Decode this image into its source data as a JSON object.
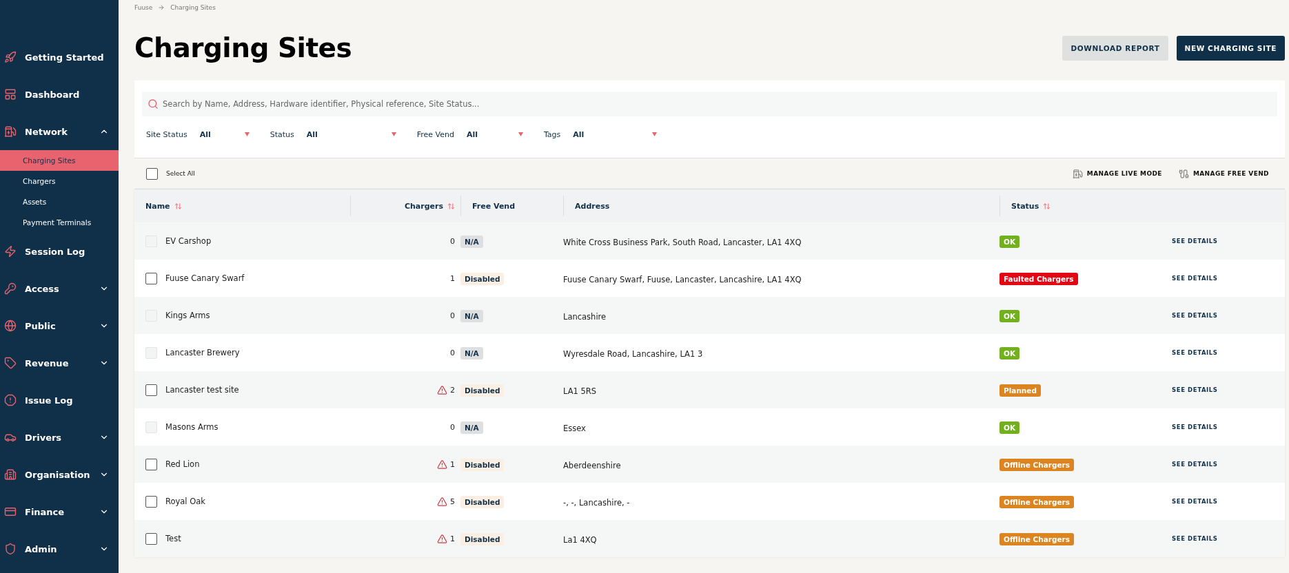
{
  "sidebar": {
    "items": [
      {
        "label": "Getting Started",
        "kind": "link",
        "selected": false
      },
      {
        "label": "Dashboard",
        "kind": "link",
        "selected": false
      },
      {
        "label": "Network",
        "kind": "group",
        "expanded": true,
        "selected": false,
        "children": [
          {
            "label": "Charging Sites",
            "selected": true
          },
          {
            "label": "Chargers",
            "selected": false
          },
          {
            "label": "Assets",
            "selected": false
          },
          {
            "label": "Payment Terminals",
            "selected": false
          }
        ]
      },
      {
        "label": "Session Log",
        "kind": "link",
        "selected": false
      },
      {
        "label": "Access",
        "kind": "group",
        "expanded": false,
        "selected": false
      },
      {
        "label": "Public",
        "kind": "group",
        "expanded": false,
        "selected": false
      },
      {
        "label": "Revenue",
        "kind": "group",
        "expanded": false,
        "selected": false
      },
      {
        "label": "Issue Log",
        "kind": "link",
        "selected": false
      },
      {
        "label": "Drivers",
        "kind": "group",
        "expanded": false,
        "selected": false
      },
      {
        "label": "Organisation",
        "kind": "group",
        "expanded": false,
        "selected": false
      },
      {
        "label": "Finance",
        "kind": "group",
        "expanded": false,
        "selected": false
      },
      {
        "label": "Admin",
        "kind": "group",
        "expanded": false,
        "selected": false
      }
    ]
  },
  "breadcrumb": [
    "Fuuse",
    "Charging Sites"
  ],
  "title": "Charging Sites",
  "buttons": [
    {
      "label": "DOWNLOAD REPORT",
      "kind": "secondary"
    },
    {
      "label": "NEW CHARGING SITE",
      "kind": "primary"
    }
  ],
  "search": {
    "placeholder": "Search by Name, Address, Hardware identifier, Physical reference, Site Status..."
  },
  "filters": [
    {
      "label": "Site Status",
      "value": "All"
    },
    {
      "label": "Status",
      "value": "All"
    },
    {
      "label": "Free Vend",
      "value": "All"
    },
    {
      "label": "Tags",
      "value": "All"
    }
  ],
  "toolbar": {
    "select_all": {
      "label": "Select All",
      "checked": false
    },
    "actions": [
      "MANAGE LIVE MODE",
      "MANAGE FREE VEND"
    ]
  },
  "table": {
    "columns": [
      {
        "label": "Name",
        "sortable": true
      },
      {
        "label": "Chargers",
        "sortable": true
      },
      {
        "label": "Free Vend",
        "sortable": false
      },
      {
        "label": "Address",
        "sortable": false
      },
      {
        "label": "Status",
        "sortable": true
      }
    ],
    "rows": [
      {
        "name": "EV Carshop",
        "disabled": true,
        "checked": false,
        "warning": false,
        "chargers": "0",
        "free_vend": {
          "label": "N/A",
          "kind": "na"
        },
        "address": "White Cross Business Park, South Road, Lancaster, LA1 4XQ",
        "status": {
          "label": "OK",
          "color": "#72b01d"
        },
        "action": "SEE DETAILS"
      },
      {
        "name": "Fuuse Canary Swarf",
        "disabled": false,
        "checked": false,
        "warning": false,
        "chargers": "1",
        "free_vend": {
          "label": "Disabled",
          "kind": "disabled"
        },
        "address": "Fuuse Canary Swarf, Fuuse, Lancaster, Lancashire, LA1 4XQ",
        "status": {
          "label": "Faulted Chargers",
          "color": "#e30613"
        },
        "action": "SEE DETAILS"
      },
      {
        "name": "Kings Arms",
        "disabled": true,
        "checked": false,
        "warning": false,
        "chargers": "0",
        "free_vend": {
          "label": "N/A",
          "kind": "na"
        },
        "address": "Lancashire",
        "status": {
          "label": "OK",
          "color": "#72b01d"
        },
        "action": "SEE DETAILS"
      },
      {
        "name": "Lancaster Brewery",
        "disabled": true,
        "checked": false,
        "warning": false,
        "chargers": "0",
        "free_vend": {
          "label": "N/A",
          "kind": "na"
        },
        "address": "Wyresdale Road, Lancashire, LA1 3",
        "status": {
          "label": "OK",
          "color": "#72b01d"
        },
        "action": "SEE DETAILS"
      },
      {
        "name": "Lancaster test site",
        "disabled": false,
        "checked": false,
        "warning": true,
        "chargers": "2",
        "free_vend": {
          "label": "Disabled",
          "kind": "disabled"
        },
        "address": "LA1 5RS",
        "status": {
          "label": "Planned",
          "color": "#dc8520"
        },
        "action": "SEE DETAILS"
      },
      {
        "name": "Masons Arms",
        "disabled": true,
        "checked": false,
        "warning": false,
        "chargers": "0",
        "free_vend": {
          "label": "N/A",
          "kind": "na"
        },
        "address": "Essex",
        "status": {
          "label": "OK",
          "color": "#72b01d"
        },
        "action": "SEE DETAILS"
      },
      {
        "name": "Red Lion",
        "disabled": false,
        "checked": false,
        "warning": true,
        "chargers": "1",
        "free_vend": {
          "label": "Disabled",
          "kind": "disabled"
        },
        "address": "Aberdeenshire",
        "status": {
          "label": "Offline Chargers",
          "color": "#dc8520"
        },
        "action": "SEE DETAILS"
      },
      {
        "name": "Royal Oak",
        "disabled": false,
        "checked": false,
        "warning": true,
        "chargers": "5",
        "free_vend": {
          "label": "Disabled",
          "kind": "disabled"
        },
        "address": "-, -, Lancashire, -",
        "status": {
          "label": "Offline Chargers",
          "color": "#dc8520"
        },
        "action": "SEE DETAILS"
      },
      {
        "name": "Test",
        "disabled": false,
        "checked": false,
        "warning": true,
        "chargers": "1",
        "free_vend": {
          "label": "Disabled",
          "kind": "disabled"
        },
        "address": "La1 4XQ",
        "status": {
          "label": "Offline Chargers",
          "color": "#dc8520"
        },
        "action": "SEE DETAILS"
      }
    ]
  }
}
